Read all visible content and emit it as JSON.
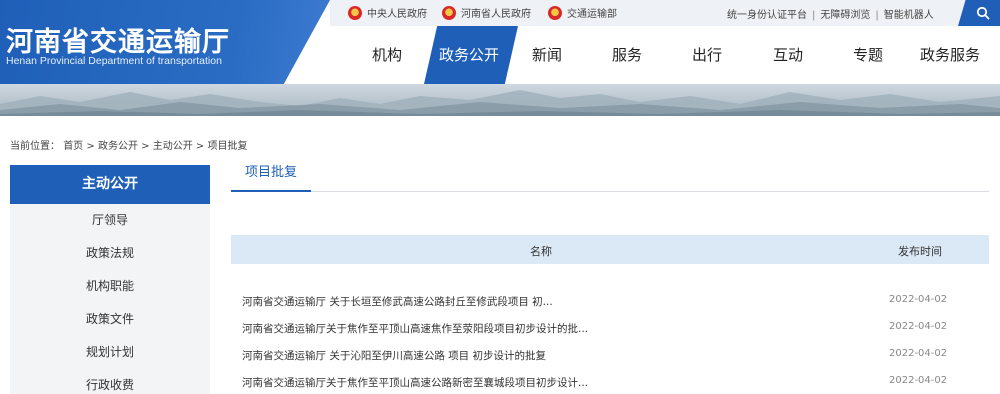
{
  "header": {
    "title_cn": "河南省交通运输厅",
    "title_en": "Henan Provincial Department of transportation",
    "top_links": [
      "中央人民政府",
      "河南省人民政府",
      "交通运输部"
    ],
    "right_links": [
      "统一身份认证平台",
      "无障碍浏览",
      "智能机器人"
    ],
    "separator": "|",
    "nav": [
      "机构",
      "政务公开",
      "新闻",
      "服务",
      "出行",
      "互动",
      "专题",
      "政务服务"
    ],
    "active_nav": "政务公开",
    "search_icon": "search-icon",
    "accent_color": "#1f5fb8"
  },
  "breadcrumb": {
    "prefix": "当前位置：",
    "items": [
      "首页",
      "政务公开",
      "主动公开",
      "项目批复"
    ],
    "separator": ">"
  },
  "sidebar": {
    "heading": "主动公开",
    "items": [
      "厅领导",
      "政策法规",
      "机构职能",
      "政策文件",
      "规划计划",
      "行政收费"
    ]
  },
  "main": {
    "tab": "项目批复",
    "columns": [
      "名称",
      "发布时间"
    ],
    "rows": [
      {
        "title": "河南省交通运输厅 关于长垣至修武高速公路封丘至修武段项目 初...",
        "date": "2022-04-02"
      },
      {
        "title": "河南省交通运输厅关于焦作至平顶山高速焦作至荥阳段项目初步设计的批...",
        "date": "2022-04-02"
      },
      {
        "title": "河南省交通运输厅 关于沁阳至伊川高速公路 项目 初步设计的批复",
        "date": "2022-04-02"
      },
      {
        "title": "河南省交通运输厅关于焦作至平顶山高速公路新密至襄城段项目初步设计...",
        "date": "2022-04-02"
      }
    ]
  }
}
